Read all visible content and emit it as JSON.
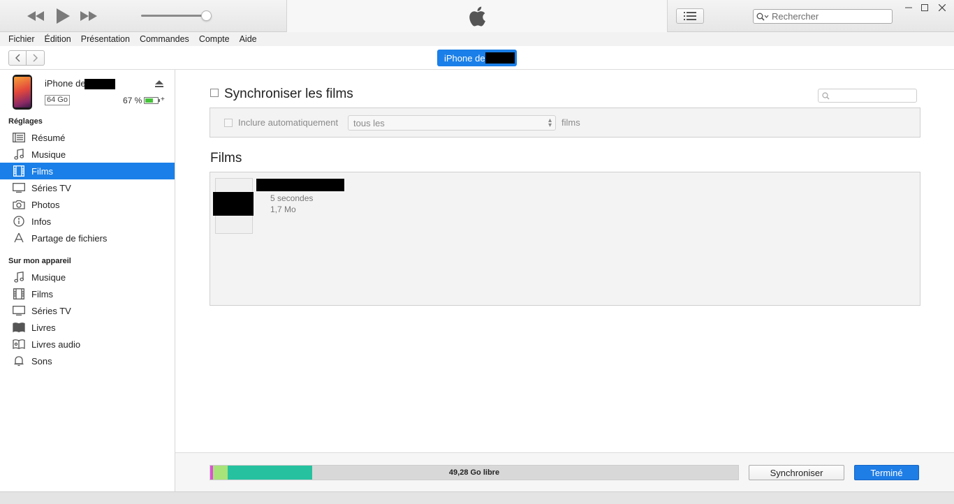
{
  "player": {
    "search_placeholder": "Rechercher",
    "volume_level": 0.9
  },
  "menu": {
    "items": [
      "Fichier",
      "Édition",
      "Présentation",
      "Commandes",
      "Compte",
      "Aide"
    ]
  },
  "nav": {
    "device_pill_label": "iPhone de"
  },
  "device": {
    "name_prefix": "iPhone de",
    "capacity": "64 Go",
    "battery_pct": "67 %",
    "battery_level": 0.67,
    "charging_symbol": "+"
  },
  "sidebar": {
    "settings_title": "Réglages",
    "settings_items": [
      {
        "label": "Résumé",
        "icon": "summary-icon"
      },
      {
        "label": "Musique",
        "icon": "music-note-icon"
      },
      {
        "label": "Films",
        "icon": "film-icon",
        "selected": true
      },
      {
        "label": "Séries TV",
        "icon": "tv-icon"
      },
      {
        "label": "Photos",
        "icon": "camera-icon"
      },
      {
        "label": "Infos",
        "icon": "info-icon"
      },
      {
        "label": "Partage de fichiers",
        "icon": "apps-icon"
      }
    ],
    "device_title": "Sur mon appareil",
    "device_items": [
      {
        "label": "Musique",
        "icon": "music-note-icon"
      },
      {
        "label": "Films",
        "icon": "film-icon"
      },
      {
        "label": "Séries TV",
        "icon": "tv-icon"
      },
      {
        "label": "Livres",
        "icon": "book-icon"
      },
      {
        "label": "Livres audio",
        "icon": "audiobook-icon"
      },
      {
        "label": "Sons",
        "icon": "bell-icon"
      }
    ]
  },
  "main": {
    "sync_title": "Synchroniser les films",
    "include_label": "Inclure automatiquement",
    "include_select_value": "tous les",
    "include_suffix": "films",
    "films_title": "Films",
    "film": {
      "duration": "5 secondes",
      "size": "1,7 Mo"
    }
  },
  "footer": {
    "storage_label": "49,28 Go libre",
    "storage_segments": [
      {
        "color": "#e04fd8",
        "fraction": 0.005
      },
      {
        "color": "#a8e37a",
        "fraction": 0.028
      },
      {
        "color": "#26c2a0",
        "fraction": 0.16
      }
    ],
    "sync_button": "Synchroniser",
    "done_button": "Terminé"
  },
  "colors": {
    "accent": "#1a7fe8"
  }
}
